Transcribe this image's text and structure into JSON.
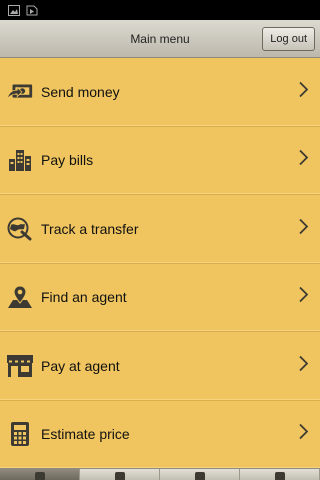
{
  "header": {
    "title": "Main menu",
    "logout_label": "Log out"
  },
  "menu": {
    "items": [
      {
        "label": "Send money",
        "icon": "money-send-icon"
      },
      {
        "label": "Pay bills",
        "icon": "buildings-icon"
      },
      {
        "label": "Track a transfer",
        "icon": "globe-search-icon"
      },
      {
        "label": "Find an agent",
        "icon": "map-pin-icon"
      },
      {
        "label": "Pay at agent",
        "icon": "storefront-icon"
      },
      {
        "label": "Estimate price",
        "icon": "calculator-icon"
      }
    ]
  },
  "colors": {
    "background": "#f0c55f",
    "divider": "#d9ad4b",
    "header": "#c8c5bb"
  }
}
